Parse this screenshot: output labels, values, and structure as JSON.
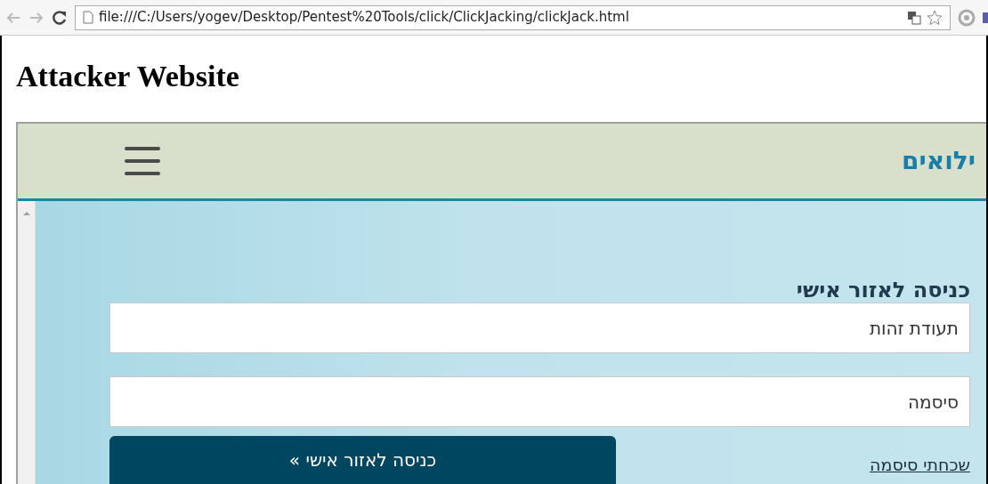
{
  "browser": {
    "back_disabled": true,
    "forward_disabled": true,
    "url": "file:///C:/Users/yogev/Desktop/Pentest%20Tools/click/ClickJacking/clickJack.html"
  },
  "page": {
    "heading": "Attacker Website"
  },
  "frame": {
    "logo": "ילואים",
    "login": {
      "title": "כניסה לאזור אישי",
      "fields": [
        {
          "placeholder": "תעודת זהות"
        },
        {
          "placeholder": "סיסמה"
        }
      ],
      "submit": {
        "label": "כניסה לאזור אישי",
        "arrow": "»"
      },
      "forgot_link": "שכחתי סיסמה"
    }
  }
}
